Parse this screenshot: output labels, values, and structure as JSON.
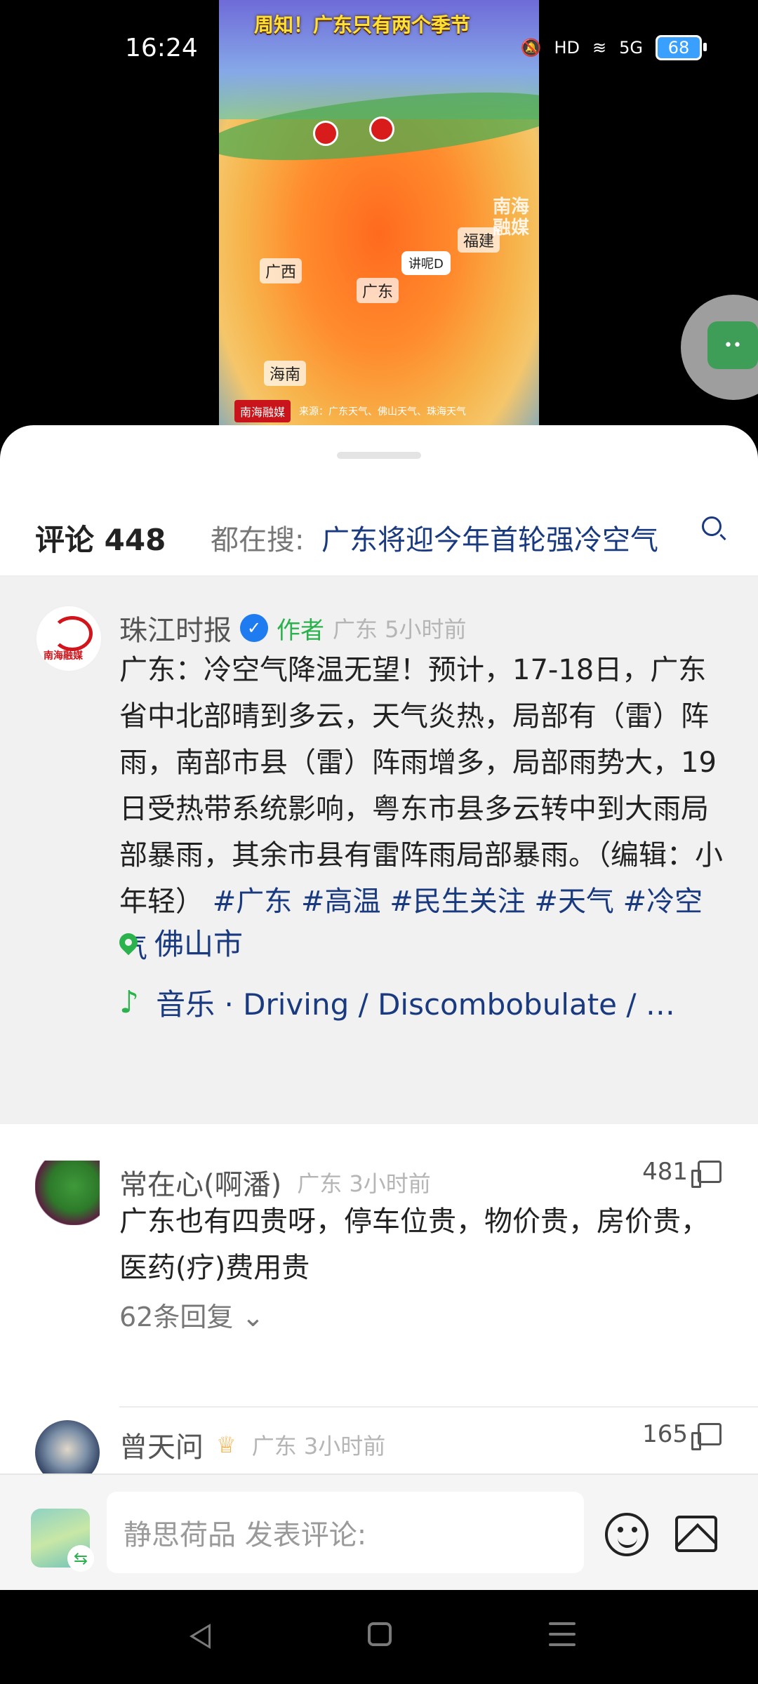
{
  "status_bar": {
    "time": "16:24",
    "icons": [
      "mute-icon",
      "hd-icon",
      "wifi-icon",
      "5g-signal-icon"
    ],
    "hd_label": "HD",
    "network_label": "5G",
    "battery": "68"
  },
  "video": {
    "headline": "周知！广东只有两个季节",
    "labels": {
      "guangxi": "广西",
      "guangdong": "广东",
      "fujian": "福建",
      "hainan": "海南"
    },
    "tag": "讲呢D",
    "watermark": "南海\n融媒",
    "footer_logo": "南海融媒",
    "footer_source": "来源：广东天气、佛山天气、珠海天气"
  },
  "comments_header": {
    "count_label": "评论 448",
    "search_lead": "都在搜:",
    "search_term": "广东将迎今年首轮强冷空气"
  },
  "author_post": {
    "name": "珠江时报",
    "avatar_text": "南海融媒",
    "badge": "作者",
    "meta": "广东 5小时前",
    "body": "广东：冷空气降温无望！预计，17-18日，广东省中北部晴到多云，天气炎热，局部有（雷）阵雨，南部市县（雷）阵雨增多，局部雨势大，19日受热带系统影响，粤东市县多云转中到大雨局部暴雨，其余市县有雷阵雨局部暴雨。（编辑：小年轻）",
    "hashtags": [
      "#广东",
      "#高温",
      "#民生关注",
      "#天气",
      "#冷空气"
    ],
    "location": "佛山市",
    "music": "音乐 · Driving / Discombobulate / …"
  },
  "comments": [
    {
      "name": "常在心(啊潘)",
      "meta": "广东 3小时前",
      "likes": "481",
      "text": "广东也有四贵呀，停车位贵，物价贵，房价贵，医药(疗)费用贵",
      "replies": "62条回复"
    },
    {
      "name": "曾天问",
      "meta": "广东 3小时前",
      "likes": "165"
    }
  ],
  "input_bar": {
    "placeholder": "静思荷品 发表评论:"
  },
  "colors": {
    "link": "#1a3a80",
    "green": "#2bb24c",
    "verified": "#1e7bf0"
  }
}
